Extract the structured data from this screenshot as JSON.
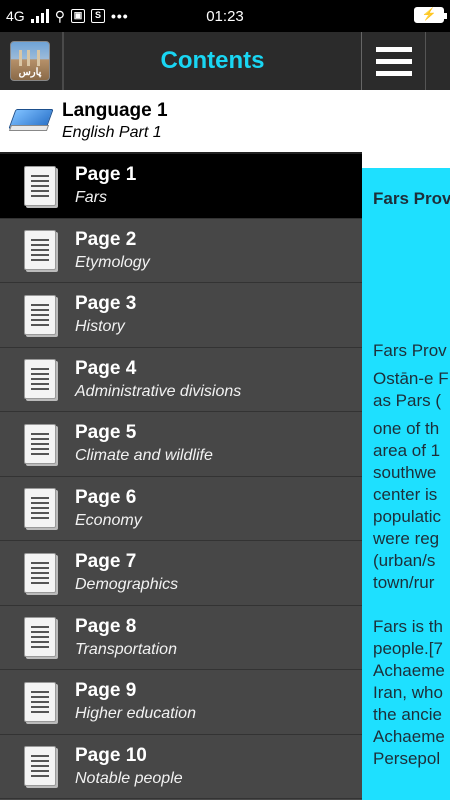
{
  "status_bar": {
    "network": "4G",
    "time": "01:23"
  },
  "drawer": {
    "title": "Contents",
    "app_icon_text": "پارس",
    "language": {
      "title": "Language 1",
      "subtitle": "English Part 1"
    },
    "pages": [
      {
        "title": "Page 1",
        "subtitle": "Fars",
        "selected": true
      },
      {
        "title": "Page 2",
        "subtitle": "Etymology"
      },
      {
        "title": "Page 3",
        "subtitle": "History"
      },
      {
        "title": "Page 4",
        "subtitle": "Administrative divisions"
      },
      {
        "title": "Page 5",
        "subtitle": "Climate and wildlife"
      },
      {
        "title": "Page 6",
        "subtitle": "Economy"
      },
      {
        "title": "Page 7",
        "subtitle": "Demographics"
      },
      {
        "title": "Page 8",
        "subtitle": "Transportation"
      },
      {
        "title": "Page 9",
        "subtitle": "Higher education"
      },
      {
        "title": "Page 10",
        "subtitle": "Notable people"
      }
    ]
  },
  "content": {
    "heading": "Fars Prov",
    "lines": [
      "Fars Prov",
      "Ostān-e F",
      "as Pars (",
      "one of th",
      "area of 1",
      "southwe",
      "center is",
      "populatic",
      "were reg",
      "(urban/s",
      "town/rur",
      "",
      "Fars is th",
      "people.[7",
      "Achaeme",
      "Iran, who",
      "the ancie",
      "Achaeme",
      "Persepol"
    ]
  },
  "colors": {
    "accent": "#19d6f3",
    "content_bg": "#1ee0ff",
    "drawer_bg": "#4a4a4a",
    "selected_bg": "#000000"
  }
}
